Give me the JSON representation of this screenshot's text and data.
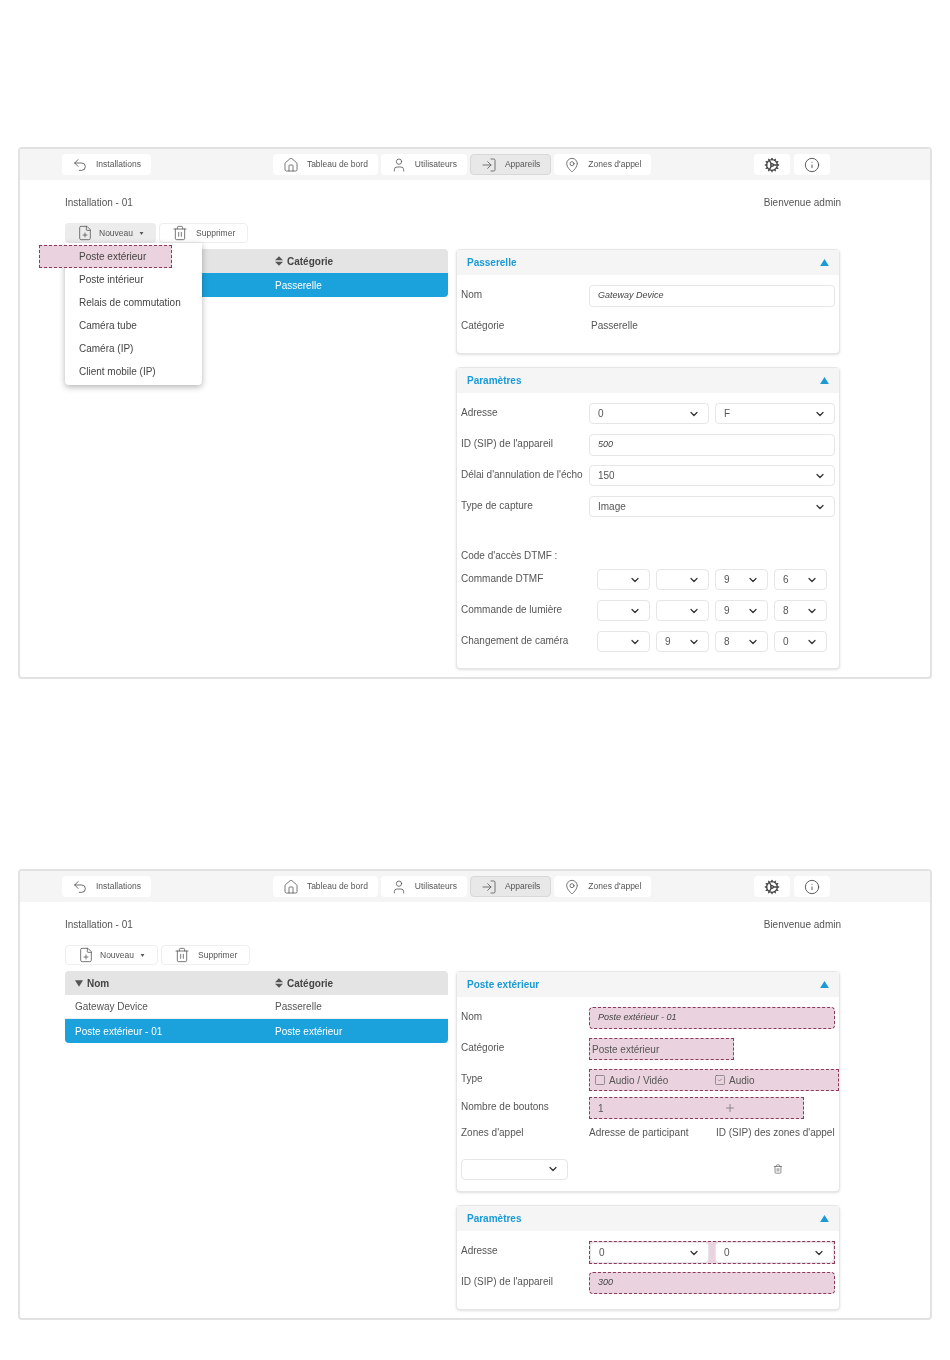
{
  "screens": [
    {
      "nav": {
        "back": "Installations",
        "tabs": [
          {
            "kind": "dashboard",
            "label": "Tableau de bord",
            "selected": false
          },
          {
            "kind": "users",
            "label": "Utilisateurs",
            "selected": false
          },
          {
            "kind": "devices",
            "label": "Appareils",
            "selected": true
          },
          {
            "kind": "zones",
            "label": "Zones d'appel",
            "selected": false
          }
        ]
      },
      "installation": "Installation - 01",
      "welcome": "Bienvenue admin",
      "toolbar": {
        "new_button": "Nouveau",
        "delete_button": "Supprimer"
      },
      "new_menu": [
        {
          "label": "Poste extérieur",
          "highlighted": true
        },
        {
          "label": "Poste intérieur",
          "highlighted": false
        },
        {
          "label": "Relais de commutation",
          "highlighted": false
        },
        {
          "label": "Caméra tube",
          "highlighted": false
        },
        {
          "label": "Caméra (IP)",
          "highlighted": false
        },
        {
          "label": "Client mobile (IP)",
          "highlighted": false
        }
      ],
      "table": {
        "columns": [
          {
            "label": "Catégorie",
            "kind": "sortable"
          }
        ],
        "rows": [
          {
            "cells": [
              "Passerelle"
            ],
            "selected": true
          }
        ]
      },
      "panels": [
        {
          "title": "Passerelle",
          "expanded": true,
          "fields": [
            {
              "kind": "input",
              "label": "Nom",
              "value": "Gateway Device",
              "highlighted": false
            },
            {
              "kind": "text",
              "label": "Catégorie",
              "value": "Passerelle",
              "highlighted": false
            }
          ]
        },
        {
          "title": "Paramètres",
          "expanded": true,
          "fields": [
            {
              "kind": "select",
              "label": "Adresse",
              "selects": [
                {
                  "kind": "filled",
                  "value": "0"
                },
                {
                  "kind": "filled",
                  "value": "F"
                }
              ],
              "highlighted": false
            },
            {
              "kind": "input",
              "label": "ID (SIP) de l'appareil",
              "value": "500",
              "highlighted": false
            },
            {
              "kind": "select",
              "label": "Délai d'annulation de l'écho",
              "selects": [
                {
                  "kind": "filled",
                  "value": "150"
                }
              ],
              "highlighted": false
            },
            {
              "kind": "select",
              "label": "Type de capture",
              "selects": [
                {
                  "kind": "filled",
                  "value": "Image"
                }
              ],
              "highlighted": false
            },
            {
              "kind": "heading",
              "label": "Code d'accès DTMF :"
            },
            {
              "kind": "select",
              "label": "Commande DTMF",
              "selects": [
                {
                  "kind": "blank"
                },
                {
                  "kind": "blank"
                },
                {
                  "kind": "filled",
                  "value": "9"
                },
                {
                  "kind": "filled",
                  "value": "6"
                }
              ],
              "highlighted": false
            },
            {
              "kind": "select",
              "label": "Commande de lumière",
              "selects": [
                {
                  "kind": "blank"
                },
                {
                  "kind": "blank"
                },
                {
                  "kind": "filled",
                  "value": "9"
                },
                {
                  "kind": "filled",
                  "value": "8"
                }
              ],
              "highlighted": false
            },
            {
              "kind": "select",
              "label": "Changement de caméra",
              "selects": [
                {
                  "kind": "blank"
                },
                {
                  "kind": "filled",
                  "value": "9"
                },
                {
                  "kind": "filled",
                  "value": "8"
                },
                {
                  "kind": "filled",
                  "value": "0"
                }
              ],
              "highlighted": false
            }
          ]
        }
      ]
    },
    {
      "nav": {
        "back": "Installations",
        "tabs": [
          {
            "kind": "dashboard",
            "label": "Tableau de bord",
            "selected": false
          },
          {
            "kind": "users",
            "label": "Utilisateurs",
            "selected": false
          },
          {
            "kind": "devices",
            "label": "Appareils",
            "selected": true
          },
          {
            "kind": "zones",
            "label": "Zones d'appel",
            "selected": false
          }
        ]
      },
      "installation": "Installation - 01",
      "welcome": "Bienvenue admin",
      "toolbar": {
        "new_button": "Nouveau",
        "delete_button": "Supprimer"
      },
      "table": {
        "columns": [
          {
            "label": "Nom",
            "kind": "sorted"
          },
          {
            "label": "Catégorie",
            "kind": "sortable"
          }
        ],
        "rows": [
          {
            "cells": [
              "Gateway Device",
              "Passerelle"
            ],
            "selected": false
          },
          {
            "cells": [
              "Poste extérieur - 01",
              "Poste extérieur"
            ],
            "selected": true
          }
        ]
      },
      "panels": [
        {
          "title": "Poste extérieur",
          "expanded": true,
          "fields": [
            {
              "kind": "input",
              "label": "Nom",
              "value": "Poste extérieur - 01",
              "highlighted": true
            },
            {
              "kind": "text",
              "label": "Catégorie",
              "value": "Poste extérieur",
              "highlighted": true
            },
            {
              "kind": "checkboxes",
              "label": "Type",
              "options": [
                {
                  "label": "Audio / Vidéo",
                  "checked": false
                },
                {
                  "label": "Audio",
                  "checked": true
                }
              ],
              "highlighted": true
            },
            {
              "kind": "stepper",
              "label": "Nombre de boutons",
              "value": "1",
              "highlighted": true
            },
            {
              "kind": "columns",
              "heads": [
                "Zones d'appel",
                "Adresse de participant",
                "ID (SIP) des zones d'appel"
              ]
            },
            {
              "kind": "zone"
            }
          ]
        },
        {
          "title": "Paramètres",
          "expanded": true,
          "fields": [
            {
              "kind": "select",
              "label": "Adresse",
              "selects": [
                {
                  "kind": "filled",
                  "value": "0"
                },
                {
                  "kind": "filled",
                  "value": "0"
                }
              ],
              "highlighted": true
            },
            {
              "kind": "input",
              "label": "ID (SIP) de l'appareil",
              "value": "300",
              "highlighted": true
            }
          ]
        }
      ]
    }
  ]
}
